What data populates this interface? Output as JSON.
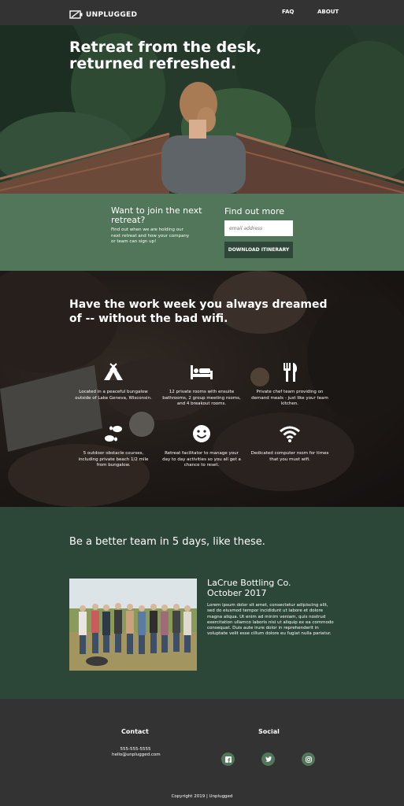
{
  "header": {
    "brand": "UNPLUGGED",
    "nav": [
      {
        "label": "FAQ"
      },
      {
        "label": "ABOUT"
      }
    ]
  },
  "hero": {
    "title_line1": "Retreat from the desk,",
    "title_line2": "returned refreshed."
  },
  "join": {
    "heading": "Want to join the next retreat?",
    "description": "Find out when we are holding our next retreat and how your company or team can sign up!",
    "find_heading": "Find out more",
    "email_placeholder": "email address",
    "button_label": "DOWNLOAD ITINERARY"
  },
  "features": {
    "title": "Have the work week you always dreamed of -- without the bad wifi.",
    "items": [
      {
        "icon": "campground-icon",
        "text": "Located in a peaceful bungalow outside of Lake Geneva, Wisconsin."
      },
      {
        "icon": "bed-icon",
        "text": "12 private rooms with ensuite bathrooms, 2 group meeting rooms, and 4 breakout rooms."
      },
      {
        "icon": "utensils-icon",
        "text": "Private chef team providing on demand meals - just like your team kitchen."
      },
      {
        "icon": "footprints-icon",
        "text": "5 outdoor obstacle courses, including private beach 1/2 mile from bungalow."
      },
      {
        "icon": "smile-icon",
        "text": "Retreat facilitator to manage your day to day activities so you all get a chance to reset."
      },
      {
        "icon": "wifi-icon",
        "text": "Dedicated computer room for times that you must wifi."
      }
    ]
  },
  "teams": {
    "title": "Be a better team in 5 days, like these.",
    "case": {
      "name": "LaCrue Bottling Co.",
      "date": "October 2017",
      "body": "Lorem ipsum dolor sit amet, consectetur adipiscing elit, sed do eiusmod tempor incididunt ut labore et dolore magna aliqua. Ut enim ad minim veniam, quis nostrud exercitation ullamco laboris nisi ut aliquip ex ea commodo consequat. Duis aute irure dolor in reprehenderit in voluptate velit esse cillum dolore eu fugiat nulla pariatur."
    }
  },
  "footer": {
    "contact_heading": "Contact",
    "phone": "555-555-5555",
    "email": "hello@unplugged.com",
    "social_heading": "Social",
    "social": [
      {
        "icon": "facebook-icon"
      },
      {
        "icon": "twitter-icon"
      },
      {
        "icon": "instagram-icon"
      }
    ],
    "copyright": "Copyright 2019 | Unplugged"
  },
  "colors": {
    "nav_bg": "#333333",
    "join_bg": "#52765a",
    "button_bg": "#2e4739",
    "teams_bg": "#2c4737",
    "footer_bg": "#333333"
  }
}
